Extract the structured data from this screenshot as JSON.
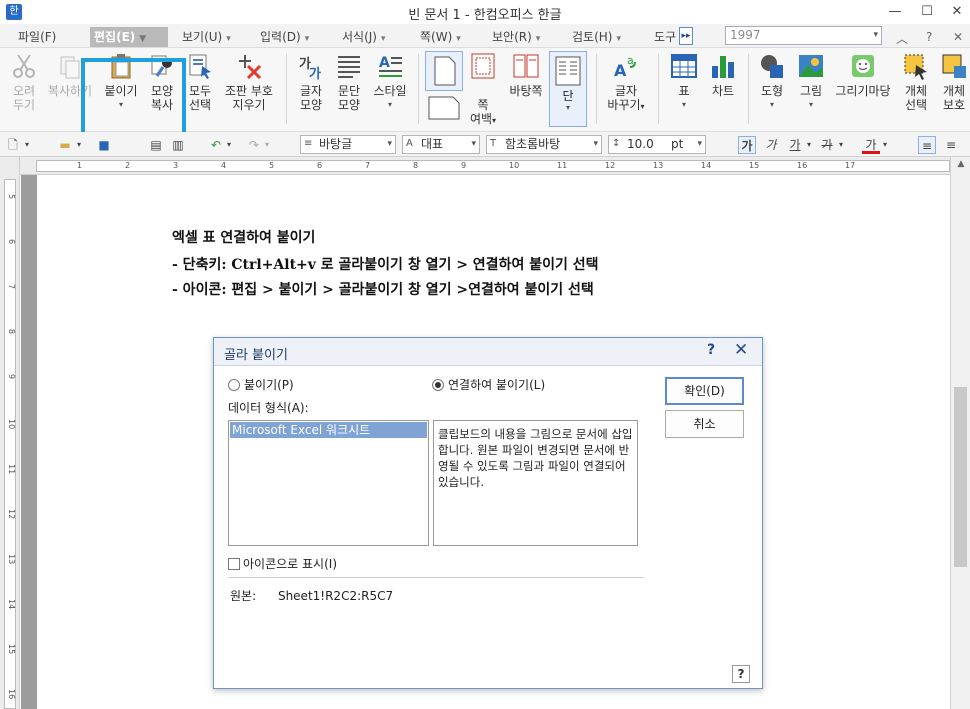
{
  "window": {
    "title": "빈 문서 1 - 한컴오피스 한글",
    "app_icon": "한"
  },
  "menubar": {
    "items": [
      {
        "label": "파일(F)"
      },
      {
        "label": "편집(E)"
      },
      {
        "label": "보기(U)"
      },
      {
        "label": "입력(D)"
      },
      {
        "label": "서식(J)"
      },
      {
        "label": "쪽(W)"
      },
      {
        "label": "보안(R)"
      },
      {
        "label": "검토(H)"
      },
      {
        "label": "도구"
      }
    ],
    "year_combo": "1997"
  },
  "ribbon": {
    "buttons": [
      {
        "label1": "오려",
        "label2": "두기"
      },
      {
        "label1": "복사하기",
        "label2": ""
      },
      {
        "label1": "붙이기",
        "label2": ""
      },
      {
        "label1": "모양",
        "label2": "복사"
      },
      {
        "label1": "모두",
        "label2": "선택"
      },
      {
        "label1": "조판 부호",
        "label2": "지우기"
      },
      {
        "label1": "글자",
        "label2": "모양"
      },
      {
        "label1": "문단",
        "label2": "모양"
      },
      {
        "label1": "스타일",
        "label2": ""
      },
      {
        "label1": "쪽",
        "label2": "여백"
      },
      {
        "label1": "바탕쪽",
        "label2": ""
      },
      {
        "label1": "단",
        "label2": ""
      },
      {
        "label1": "글자",
        "label2": "바꾸기"
      },
      {
        "label1": "표",
        "label2": ""
      },
      {
        "label1": "차트",
        "label2": ""
      },
      {
        "label1": "도형",
        "label2": ""
      },
      {
        "label1": "그림",
        "label2": ""
      },
      {
        "label1": "그리기마당",
        "label2": ""
      },
      {
        "label1": "개체",
        "label2": "선택"
      },
      {
        "label1": "개체",
        "label2": "보호"
      }
    ]
  },
  "format_toolbar": {
    "style": "바탕글",
    "font_lang": "대표",
    "font": "함초롬바탕",
    "size": "10.0",
    "size_unit": "pt",
    "bold": "가",
    "italic": "가",
    "underline": "가",
    "strike": "가",
    "color": "가"
  },
  "ruler": {
    "h_numbers": [
      "1",
      "2",
      "3",
      "4",
      "5",
      "6",
      "7",
      "8",
      "9",
      "10",
      "11",
      "12",
      "13",
      "14",
      "15",
      "16",
      "17"
    ],
    "v_numbers": [
      "5",
      "6",
      "7",
      "8",
      "9",
      "10",
      "11",
      "12",
      "13",
      "14",
      "15",
      "16"
    ]
  },
  "document": {
    "lines": [
      "엑셀 표 연결하여 붙이기",
      "- 단축키: Ctrl+Alt+v 로 골라붙이기 창 열기 > 연결하여 붙이기 선택",
      "- 아이콘: 편집 > 붙이기 > 골라붙이기 창 열기 >연결하여 붙이기 선택"
    ]
  },
  "dialog": {
    "title": "골라 붙이기",
    "help": "?",
    "close": "✕",
    "radio_paste": "붙이기(P)",
    "radio_link": "연결하여 붙이기(L)",
    "data_format_label": "데이터 형식(A):",
    "list_items": [
      "Microsoft Excel 워크시트"
    ],
    "description": "클립보드의 내용을 그림으로 문서에 삽입합니다. 원본 파일이 변경되면 문서에 반영될 수 있도록 그림과 파일이 연결되어 있습니다.",
    "ok": "확인(D)",
    "cancel": "취소",
    "icon_checkbox": "아이콘으로 표시(I)",
    "source_label": "원본:",
    "source_value": "Sheet1!R2C2:R5C7",
    "help_button": "?"
  },
  "colors": {
    "highlight": "#1e9fe0",
    "dialog_border": "#6f94c2",
    "list_selection": "#7fa3d4"
  }
}
